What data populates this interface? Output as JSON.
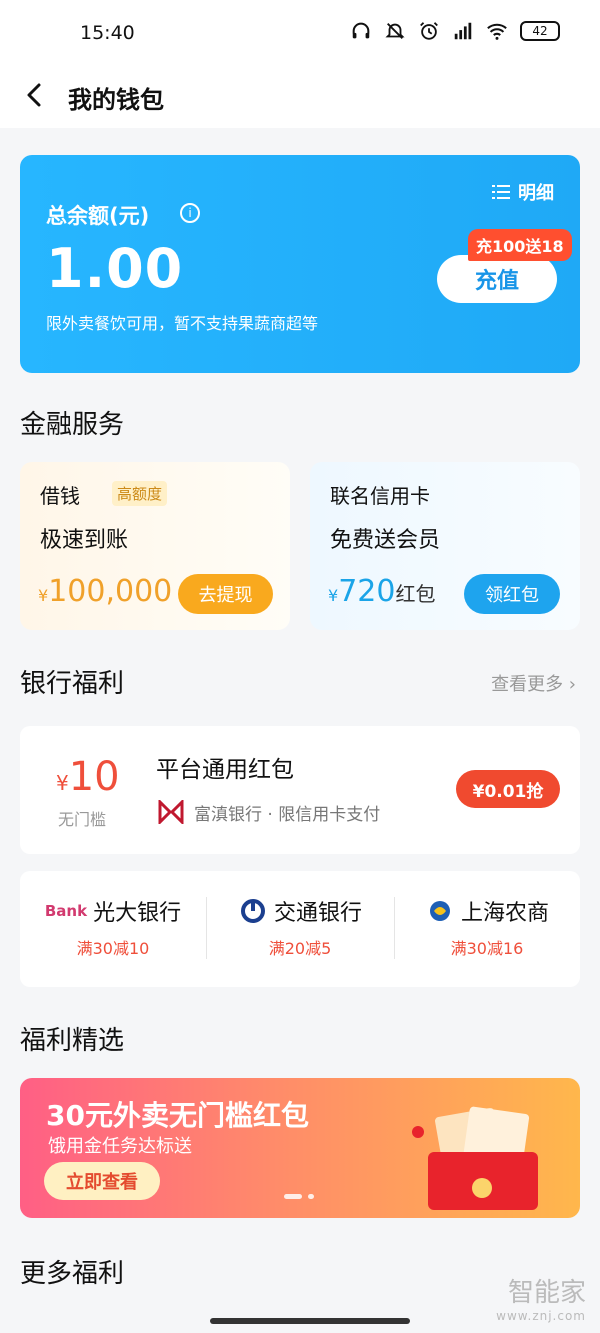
{
  "status_bar": {
    "time": "15:40",
    "battery": "42",
    "icons": [
      "headphones-icon",
      "mute-icon",
      "alarm-icon",
      "signal-icon",
      "wifi-icon",
      "battery-icon"
    ]
  },
  "header": {
    "title": "我的钱包"
  },
  "wallet": {
    "balance_label": "总余额(元)",
    "balance": "1.00",
    "limit_note": "限外卖餐饮可用，暂不支持果蔬商超等",
    "detail_label": "明细",
    "recharge_label": "充值",
    "promo_badge": "充100送18",
    "accent": "#1fa9f6"
  },
  "finance": {
    "section_title": "金融服务",
    "loan": {
      "name": "借钱",
      "tag": "高额度",
      "subtitle": "极速到账",
      "currency": "¥",
      "amount": "100,000",
      "button": "去提现"
    },
    "credit_card": {
      "name": "联名信用卡",
      "subtitle": "免费送会员",
      "currency": "¥",
      "amount": "720",
      "unit": "红包",
      "button": "领红包"
    }
  },
  "bank_benefits": {
    "section_title": "银行福利",
    "more_label": "查看更多 ›",
    "coupon": {
      "currency": "¥",
      "amount": "10",
      "condition": "无门槛",
      "name": "平台通用红包",
      "description": "富滇银行 · 限信用卡支付",
      "button": "¥0.01抢"
    },
    "banks": [
      {
        "name": "光大银行",
        "deal": "满30减10",
        "logo": "Bank"
      },
      {
        "name": "交通银行",
        "deal": "满20减5"
      },
      {
        "name": "上海农商",
        "deal": "满30减16"
      }
    ]
  },
  "featured": {
    "section_title": "福利精选",
    "banner": {
      "title": "30元外卖无门槛红包",
      "subtitle": "饿用金任务达标送",
      "button": "立即查看"
    }
  },
  "more": {
    "section_title": "更多福利"
  },
  "watermark": {
    "line1": "智能家",
    "line2": "www.znj.com"
  }
}
